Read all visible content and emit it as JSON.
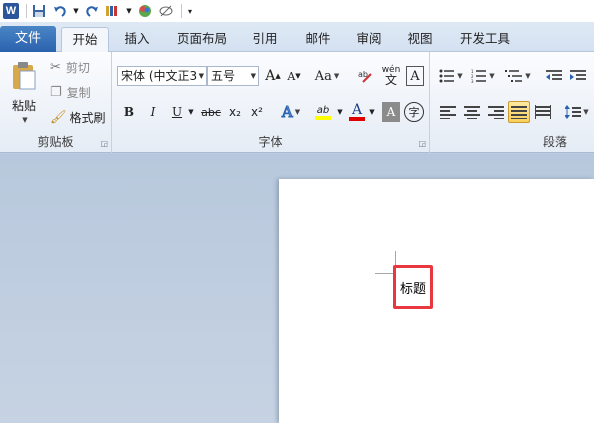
{
  "quick_access": {
    "icons": [
      "word-logo-icon",
      "save-icon",
      "undo-icon",
      "redo-icon",
      "format-painter-icon",
      "color-icon",
      "eraser-icon",
      "customize-icon"
    ],
    "logo_letter": "W"
  },
  "tabs": [
    {
      "label": "文件"
    },
    {
      "label": "开始"
    },
    {
      "label": "插入"
    },
    {
      "label": "页面布局"
    },
    {
      "label": "引用"
    },
    {
      "label": "邮件"
    },
    {
      "label": "审阅"
    },
    {
      "label": "视图"
    },
    {
      "label": "开发工具"
    }
  ],
  "clipboard": {
    "paste_label": "粘贴",
    "cut_label": "剪切",
    "copy_label": "复制",
    "format_painter_label": "格式刷",
    "group_label": "剪贴板"
  },
  "font": {
    "font_name": "宋体 (中文正3",
    "font_size": "五号",
    "group_label": "字体",
    "bold": "B",
    "italic": "I",
    "underline": "U",
    "strike": "abc",
    "subscript": "x₂",
    "superscript": "x²",
    "change_case": "Aa",
    "grow": "A",
    "shrink": "A",
    "phonetic": "wén",
    "char_border": "A",
    "text_effect": "A",
    "highlight": "ab",
    "font_color": "A",
    "char_shading": "A",
    "enclose": "字",
    "font_color_value": "#e00000",
    "highlight_value": "#ffff00"
  },
  "paragraph": {
    "group_label": "段落"
  },
  "document": {
    "title_text": "标题"
  },
  "colors": {
    "file_tab": "#2a62ad",
    "highlight_box": "#e8373f",
    "active_align": "#f8cf5b"
  }
}
